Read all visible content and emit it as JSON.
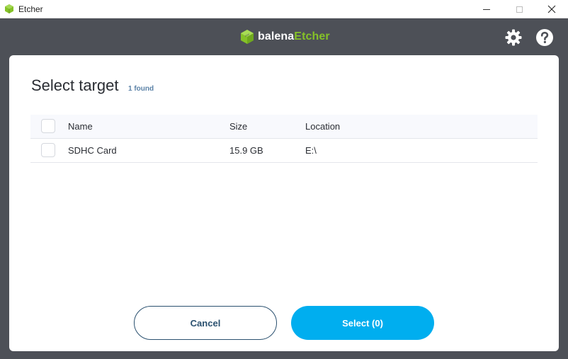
{
  "window": {
    "title": "Etcher"
  },
  "header": {
    "brand_prefix": "balena",
    "brand_suffix": "Etcher",
    "icons": [
      "gear-icon",
      "help-icon"
    ]
  },
  "modal": {
    "title": "Select target",
    "found_count": "1 found",
    "columns": {
      "name": "Name",
      "size": "Size",
      "location": "Location"
    },
    "rows": [
      {
        "name": "SDHC Card",
        "size": "15.9 GB",
        "location": "E:\\"
      }
    ],
    "cancel_label": "Cancel",
    "select_label": "Select (0)"
  },
  "colors": {
    "header_bg": "#4d5057",
    "brand_green": "#85c228",
    "primary_blue": "#00aeef",
    "outline_blue": "#2a506f"
  }
}
